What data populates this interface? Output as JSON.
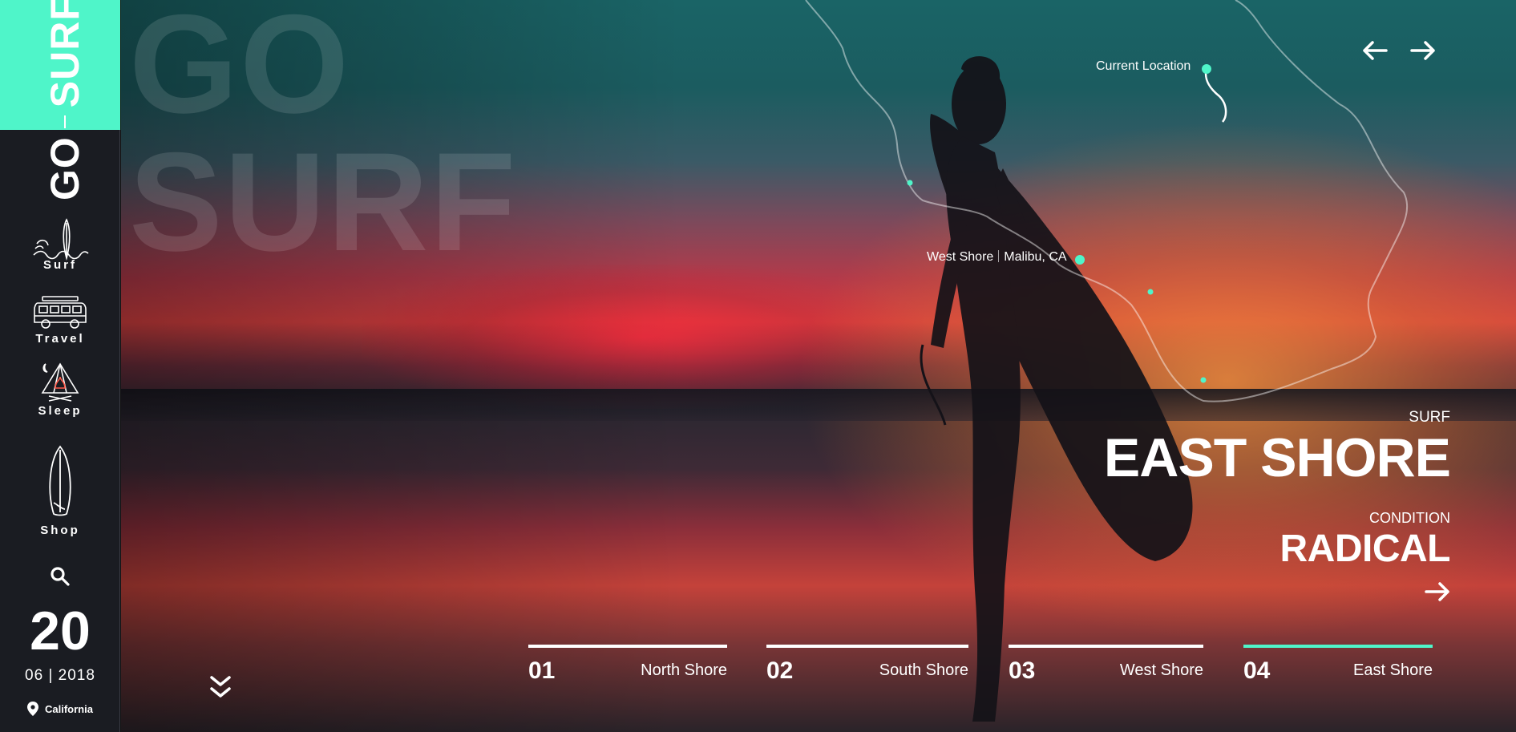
{
  "brand": {
    "word_go": "GO",
    "word_surf": "SURF",
    "background_title_line1": "GO",
    "background_title_line2": "SURF",
    "accent_color": "#4ff5c9"
  },
  "sidebar": {
    "items": [
      {
        "label": "Surf",
        "icon": "surfboard-waves-icon"
      },
      {
        "label": "Travel",
        "icon": "van-icon"
      },
      {
        "label": "Sleep",
        "icon": "tent-campfire-icon"
      },
      {
        "label": "Shop",
        "icon": "surfboard-icon"
      }
    ],
    "search_icon": "search-icon",
    "date": {
      "day": "20",
      "month_year": "06 | 2018"
    },
    "location": "California"
  },
  "map": {
    "current_location_label": "Current Location",
    "marker_label_place": "West Shore",
    "marker_label_city": "Malibu, CA"
  },
  "navigation": {
    "prev": "arrow-left-icon",
    "next": "arrow-right-icon"
  },
  "spot": {
    "kicker": "SURF",
    "title": "EAST SHORE",
    "condition_label": "CONDITION",
    "condition_value": "RADICAL"
  },
  "tabs": [
    {
      "number": "01",
      "name": "North Shore",
      "active": false
    },
    {
      "number": "02",
      "name": "South Shore",
      "active": false
    },
    {
      "number": "03",
      "name": "West Shore",
      "active": false
    },
    {
      "number": "04",
      "name": "East Shore",
      "active": true
    }
  ]
}
